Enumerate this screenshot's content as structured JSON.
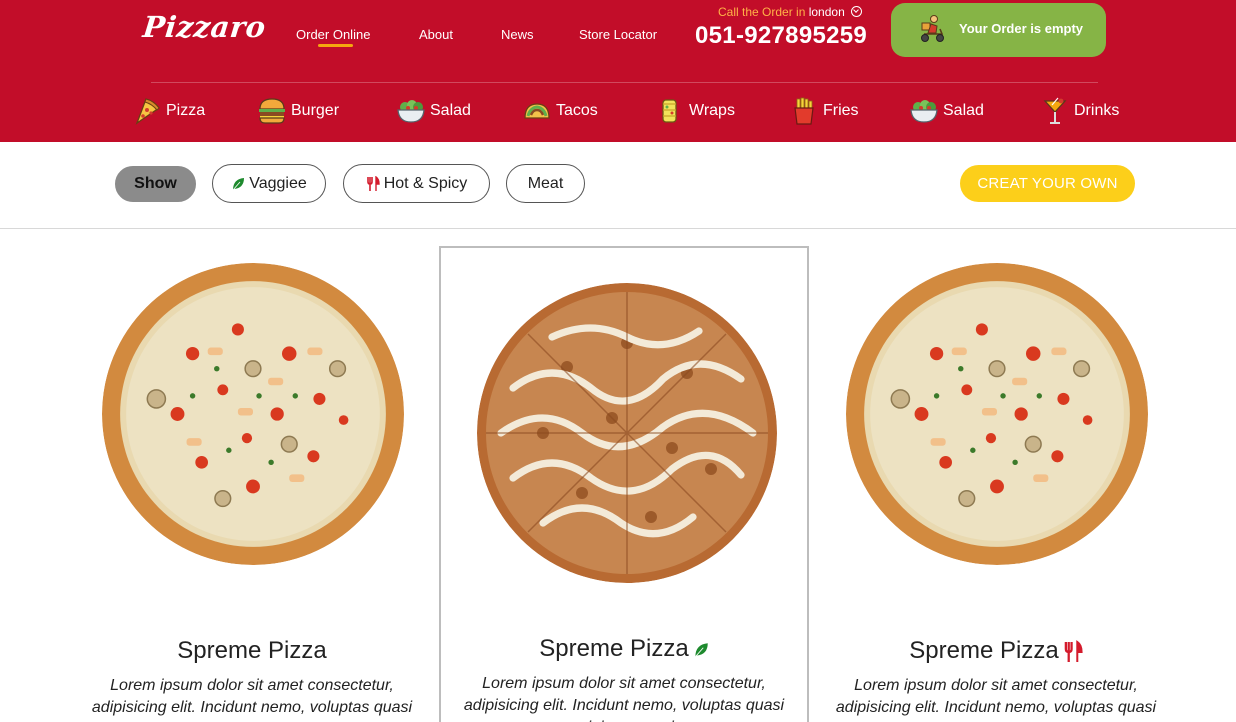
{
  "brand": {
    "logo": "Pizzaro"
  },
  "topnav": [
    {
      "label": "Order Online",
      "active": true
    },
    {
      "label": "About",
      "active": false
    },
    {
      "label": "News",
      "active": false
    },
    {
      "label": "Store Locator",
      "active": false
    }
  ],
  "contact": {
    "call_prefix": "Call the Order in",
    "city": "london",
    "phone": "051-927895259"
  },
  "cart": {
    "label": "Your Order is empty",
    "icon": "scooter-icon"
  },
  "categories": [
    {
      "label": "Pizza",
      "icon": "pizza-icon"
    },
    {
      "label": "Burger",
      "icon": "burger-icon"
    },
    {
      "label": "Salad",
      "icon": "salad-icon"
    },
    {
      "label": "Tacos",
      "icon": "tacos-icon"
    },
    {
      "label": "Wraps",
      "icon": "wraps-icon"
    },
    {
      "label": "Fries",
      "icon": "fries-icon"
    },
    {
      "label": "Salad",
      "icon": "salad-icon"
    },
    {
      "label": "Drinks",
      "icon": "drinks-icon"
    }
  ],
  "filters": {
    "show": "Show",
    "vaggiee": "Vaggiee",
    "hot_spicy": "Hot & Spicy",
    "meat": "Meat",
    "create": "CREAT YOUR OWN"
  },
  "products": [
    {
      "name": "Spreme Pizza",
      "badge": "",
      "desc": "Lorem ipsum dolor sit amet consectetur, adipisicing elit. Incidunt nemo, voluptas quasi minima magni"
    },
    {
      "name": "Spreme Pizza",
      "badge": "leaf-icon",
      "desc": "Lorem ipsum dolor sit amet consectetur, adipisicing elit. Incidunt nemo, voluptas quasi minima magni"
    },
    {
      "name": "Spreme Pizza",
      "badge": "fork-knife-icon",
      "desc": "Lorem ipsum dolor sit amet consectetur, adipisicing elit. Incidunt nemo, voluptas quasi minima magni"
    }
  ],
  "colors": {
    "header": "#c20d29",
    "cart": "#86b446",
    "create": "#fccf1a",
    "accent": "#f5a70f"
  }
}
